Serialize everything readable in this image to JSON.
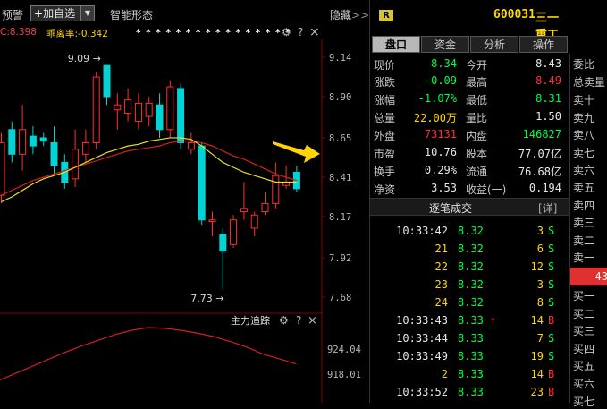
{
  "toolbar": {
    "alert_label": "预警",
    "add_watch_label": "加自选",
    "smart_shape_label": "智能形态",
    "hide_label": "隐藏",
    "hide_arrows": ">>"
  },
  "indicator": {
    "text_a": "C:8.398",
    "text_b": "乖离率:-0.342",
    "stars": "* * * * * * * *    * * * * * * * *",
    "gear_icon": "⚙",
    "help_icon": "?",
    "close_icon": "×"
  },
  "chart_data": {
    "type": "candlestick",
    "y_ticks": [
      "9.14",
      "8.90",
      "8.65",
      "8.41",
      "8.17",
      "7.92",
      "7.68"
    ],
    "ylim": [
      7.68,
      9.14
    ],
    "annotations": [
      {
        "text": "9.09",
        "arrow": "→",
        "price": 9.09
      },
      {
        "text": "7.73",
        "arrow": "→",
        "price": 7.73
      }
    ],
    "candles": [
      {
        "o": 8.3,
        "c": 8.62,
        "h": 8.68,
        "l": 8.25,
        "up": true
      },
      {
        "o": 8.55,
        "c": 8.7,
        "h": 8.75,
        "l": 8.5,
        "up": false
      },
      {
        "o": 8.7,
        "c": 8.55,
        "h": 8.85,
        "l": 8.45,
        "up": true
      },
      {
        "o": 8.6,
        "c": 8.66,
        "h": 8.72,
        "l": 8.55,
        "up": false
      },
      {
        "o": 8.65,
        "c": 8.63,
        "h": 8.68,
        "l": 8.6,
        "up": false
      },
      {
        "o": 8.62,
        "c": 8.48,
        "h": 8.72,
        "l": 8.42,
        "up": false
      },
      {
        "o": 8.5,
        "c": 8.38,
        "h": 8.55,
        "l": 8.34,
        "up": false
      },
      {
        "o": 8.4,
        "c": 8.58,
        "h": 8.7,
        "l": 8.35,
        "up": true
      },
      {
        "o": 8.55,
        "c": 8.62,
        "h": 8.7,
        "l": 8.5,
        "up": true
      },
      {
        "o": 8.62,
        "c": 9.02,
        "h": 9.05,
        "l": 8.58,
        "up": true
      },
      {
        "o": 9.09,
        "c": 8.9,
        "h": 9.09,
        "l": 8.85,
        "up": false
      },
      {
        "o": 8.85,
        "c": 8.82,
        "h": 8.92,
        "l": 8.7,
        "up": true
      },
      {
        "o": 8.8,
        "c": 8.88,
        "h": 8.95,
        "l": 8.75,
        "up": true
      },
      {
        "o": 8.86,
        "c": 8.75,
        "h": 8.92,
        "l": 8.7,
        "up": true
      },
      {
        "o": 8.78,
        "c": 8.86,
        "h": 8.9,
        "l": 8.72,
        "up": true
      },
      {
        "o": 8.85,
        "c": 8.7,
        "h": 8.92,
        "l": 8.65,
        "up": false
      },
      {
        "o": 8.7,
        "c": 8.96,
        "h": 9.0,
        "l": 8.65,
        "up": true
      },
      {
        "o": 8.95,
        "c": 8.62,
        "h": 8.98,
        "l": 8.58,
        "up": false
      },
      {
        "o": 8.62,
        "c": 8.58,
        "h": 8.68,
        "l": 8.55,
        "up": true
      },
      {
        "o": 8.6,
        "c": 8.15,
        "h": 8.62,
        "l": 8.12,
        "up": false
      },
      {
        "o": 8.15,
        "c": 8.14,
        "h": 8.2,
        "l": 8.05,
        "up": true
      },
      {
        "o": 8.06,
        "c": 7.96,
        "h": 8.1,
        "l": 7.73,
        "up": false
      },
      {
        "o": 8.15,
        "c": 8.0,
        "h": 8.18,
        "l": 7.98,
        "up": true
      },
      {
        "o": 8.2,
        "c": 8.22,
        "h": 8.38,
        "l": 8.15,
        "up": true
      },
      {
        "o": 8.1,
        "c": 8.18,
        "h": 8.2,
        "l": 8.05,
        "up": true
      },
      {
        "o": 8.2,
        "c": 8.25,
        "h": 8.32,
        "l": 8.18,
        "up": true
      },
      {
        "o": 8.25,
        "c": 8.42,
        "h": 8.5,
        "l": 8.22,
        "up": true
      },
      {
        "o": 8.36,
        "c": 8.38,
        "h": 8.48,
        "l": 8.34,
        "up": true
      },
      {
        "o": 8.44,
        "c": 8.34,
        "h": 8.48,
        "l": 8.32,
        "up": false
      }
    ],
    "ma_yellow": [
      8.26,
      8.29,
      8.33,
      8.37,
      8.4,
      8.42,
      8.44,
      8.47,
      8.5,
      8.53,
      8.56,
      8.58,
      8.6,
      8.61,
      8.63,
      8.64,
      8.65,
      8.65,
      8.64,
      8.6,
      8.55,
      8.5,
      8.47,
      8.44,
      8.42,
      8.4,
      8.38,
      8.38,
      8.38
    ],
    "ma_red": [
      8.3,
      8.33,
      8.36,
      8.39,
      8.41,
      8.43,
      8.45,
      8.47,
      8.49,
      8.51,
      8.53,
      8.55,
      8.57,
      8.58,
      8.59,
      8.6,
      8.62,
      8.63,
      8.63,
      8.62,
      8.6,
      8.57,
      8.54,
      8.52,
      8.49,
      8.46,
      8.43,
      8.41,
      8.39
    ],
    "sub_title": "主力追踪",
    "sub_ticks": [
      "924.04",
      "918.01"
    ],
    "sub_line": [
      0.25,
      0.35,
      0.45,
      0.55,
      0.65,
      0.74,
      0.82,
      0.9,
      0.96,
      1.0,
      0.99,
      0.96,
      0.92,
      0.87,
      0.8,
      0.72,
      0.62,
      0.55,
      0.48
    ]
  },
  "quote": {
    "badge": "R",
    "code": "600031",
    "name": "三一重工",
    "tabs": [
      "盘口",
      "资金",
      "分析",
      "操作"
    ],
    "rows": [
      {
        "l1": "现价",
        "v1": "8.34",
        "c1": "green",
        "l2": "今开",
        "v2": "8.43",
        "c2": "white"
      },
      {
        "l1": "涨跌",
        "v1": "-0.09",
        "c1": "green",
        "l2": "最高",
        "v2": "8.49",
        "c2": "red"
      },
      {
        "l1": "涨幅",
        "v1": "-1.07%",
        "c1": "green",
        "l2": "最低",
        "v2": "8.31",
        "c2": "green"
      },
      {
        "l1": "总量",
        "v1": "22.00万",
        "c1": "yellow",
        "l2": "量比",
        "v2": "1.50",
        "c2": "white"
      },
      {
        "l1": "外盘",
        "v1": "73131",
        "c1": "red",
        "l2": "内盘",
        "v2": "146827",
        "c2": "green"
      },
      {
        "l1": "市盈",
        "v1": "10.76",
        "c1": "white",
        "l2": "股本",
        "v2": "77.07亿",
        "c2": "white"
      },
      {
        "l1": "换手",
        "v1": "0.29%",
        "c1": "white",
        "l2": "流通",
        "v2": "76.68亿",
        "c2": "white"
      },
      {
        "l1": "净资",
        "v1": "3.53",
        "c1": "white",
        "l2": "收益(一)",
        "v2": "0.194",
        "c2": "white"
      }
    ],
    "orderbook": {
      "top_labels": [
        {
          "text": "委比",
          "color": "lbl"
        },
        {
          "text": "总卖量",
          "color": "green"
        }
      ],
      "sell": [
        "卖十",
        "卖九",
        "卖八",
        "卖七",
        "卖六",
        "卖五",
        "卖四",
        "卖三",
        "卖二",
        "卖一"
      ],
      "mid_value": "43",
      "buy": [
        "买一",
        "买二",
        "买三",
        "买四",
        "买五",
        "买六",
        "买七"
      ]
    },
    "trades_title": "逐笔成交",
    "trades_detail": "[详]",
    "trades": [
      {
        "time": "10:33:42",
        "tcolor": "white",
        "price": "8.32",
        "vol": "3",
        "vcolor": "yellow",
        "side": "S",
        "scolor": "green",
        "up": ""
      },
      {
        "time": "21",
        "tcolor": "yellow",
        "price": "8.32",
        "vol": "6",
        "vcolor": "yellow",
        "side": "S",
        "scolor": "green",
        "up": ""
      },
      {
        "time": "22",
        "tcolor": "yellow",
        "price": "8.32",
        "vol": "12",
        "vcolor": "yellow",
        "side": "S",
        "scolor": "green",
        "up": ""
      },
      {
        "time": "23",
        "tcolor": "yellow",
        "price": "8.32",
        "vol": "3",
        "vcolor": "yellow",
        "side": "S",
        "scolor": "green",
        "up": ""
      },
      {
        "time": "24",
        "tcolor": "yellow",
        "price": "8.32",
        "vol": "8",
        "vcolor": "yellow",
        "side": "S",
        "scolor": "green",
        "up": ""
      },
      {
        "time": "10:33:43",
        "tcolor": "white",
        "price": "8.33",
        "vol": "14",
        "vcolor": "yellow",
        "side": "B",
        "scolor": "red",
        "up": "↑"
      },
      {
        "time": "10:33:44",
        "tcolor": "white",
        "price": "8.33",
        "vol": "7",
        "vcolor": "yellow",
        "side": "S",
        "scolor": "green",
        "up": ""
      },
      {
        "time": "10:33:49",
        "tcolor": "white",
        "price": "8.33",
        "vol": "19",
        "vcolor": "yellow",
        "side": "S",
        "scolor": "green",
        "up": ""
      },
      {
        "time": "2",
        "tcolor": "yellow",
        "price": "8.33",
        "vol": "14",
        "vcolor": "yellow",
        "side": "B",
        "scolor": "red",
        "up": ""
      },
      {
        "time": "10:33:52",
        "tcolor": "white",
        "price": "8.33",
        "vol": "23",
        "vcolor": "yellow",
        "side": "B",
        "scolor": "red",
        "up": ""
      }
    ]
  }
}
